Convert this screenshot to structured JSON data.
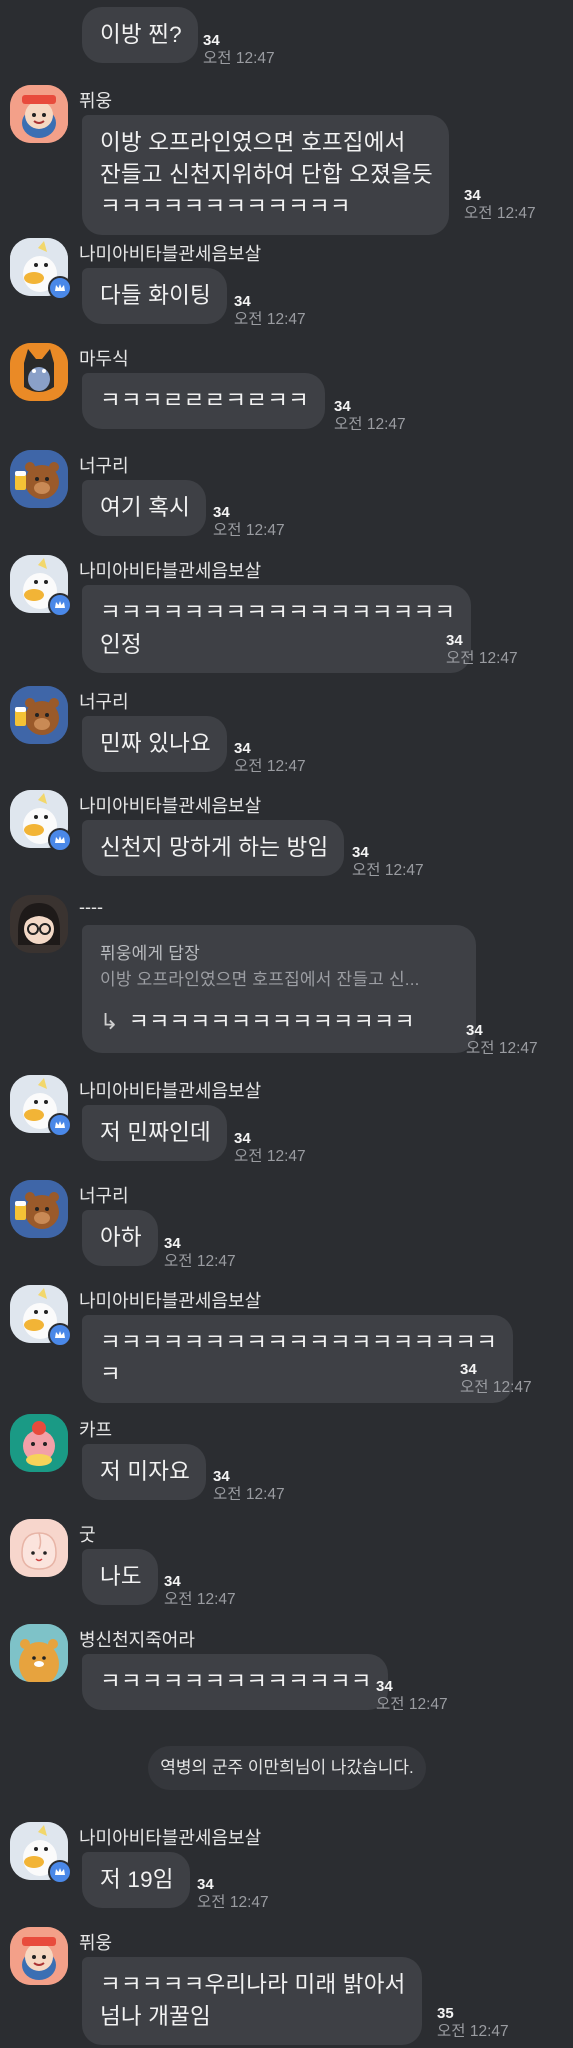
{
  "messages": [
    {
      "sender": "",
      "lines": [
        "이방 찐?"
      ],
      "count": "34",
      "time": "오전 12:47"
    },
    {
      "sender": "퓌웅",
      "lines": [
        "이방 오프라인였으면 호프집에서",
        "잔들고 신천지위하여 단합 오졌을듯",
        "ㅋㅋㅋㅋㅋㅋㅋㅋㅋㅋㅋㅋ"
      ],
      "count": "34",
      "time": "오전 12:47"
    },
    {
      "sender": "나미아비타블관세음보살",
      "lines": [
        "다들 화이팅"
      ],
      "count": "34",
      "time": "오전 12:47"
    },
    {
      "sender": "마두식",
      "lines": [
        "ㅋㅋㅋㄹㄹㄹㅋㄹㅋㅋ"
      ],
      "count": "34",
      "time": "오전 12:47"
    },
    {
      "sender": "너구리",
      "lines": [
        "여기 혹시"
      ],
      "count": "34",
      "time": "오전 12:47"
    },
    {
      "sender": "나미아비타블관세음보살",
      "lines": [
        "ㅋㅋㅋㅋㅋㅋㅋㅋㅋㅋㅋㅋㅋㅋㅋㅋㅋ",
        "인정"
      ],
      "count": "34",
      "time": "오전 12:47"
    },
    {
      "sender": "너구리",
      "lines": [
        "민짜 있나요"
      ],
      "count": "34",
      "time": "오전 12:47"
    },
    {
      "sender": "나미아비타블관세음보살",
      "lines": [
        "신천지 망하게 하는 방임"
      ],
      "count": "34",
      "time": "오전 12:47"
    },
    {
      "sender": "----",
      "reply_to": "퓌웅에게 답장",
      "quote": "이방 오프라인였으면 호프집에서 잔들고 신...",
      "lines": [
        "ㅋㅋㅋㅋㅋㅋㅋㅋㅋㅋㅋㅋㅋㅋ"
      ],
      "count": "34",
      "time": "오전 12:47"
    },
    {
      "sender": "나미아비타블관세음보살",
      "lines": [
        "저 민짜인데"
      ],
      "count": "34",
      "time": "오전 12:47"
    },
    {
      "sender": "너구리",
      "lines": [
        "아하"
      ],
      "count": "34",
      "time": "오전 12:47"
    },
    {
      "sender": "나미아비타블관세음보살",
      "lines": [
        "ㅋㅋㅋㅋㅋㅋㅋㅋㅋㅋㅋㅋㅋㅋㅋㅋㅋㅋㅋ",
        "ㅋ"
      ],
      "count": "34",
      "time": "오전 12:47"
    },
    {
      "sender": "카프",
      "lines": [
        "저 미자요"
      ],
      "count": "34",
      "time": "오전 12:47"
    },
    {
      "sender": "굿",
      "lines": [
        "나도"
      ],
      "count": "34",
      "time": "오전 12:47"
    },
    {
      "sender": "병신천지죽어라",
      "lines": [
        "ㅋㅋㅋㅋㅋㅋㅋㅋㅋㅋㅋㅋㅋ"
      ],
      "count": "34",
      "time": "오전 12:47"
    },
    {
      "sender": "나미아비타블관세음보살",
      "lines": [
        "저 19임"
      ],
      "count": "34",
      "time": "오전 12:47"
    },
    {
      "sender": "퓌웅",
      "lines": [
        "ㅋㅋㅋㅋㅋ우리나라 미래 밝아서",
        "넘나 개꿀임"
      ],
      "count": "35",
      "time": "오전 12:47"
    }
  ],
  "notice": "역병의 군주 이만희님이 나갔습니다.",
  "avatar_styles": {
    "punch": {
      "bg": "#f3a089",
      "icon": "punch-character-avatar-icon"
    },
    "duck": {
      "bg": "#dfe6ee",
      "icon": "duck-character-avatar-icon"
    },
    "muzi": {
      "bg": "#ea8a26",
      "icon": "black-cat-avatar-icon"
    },
    "bear": {
      "bg": "#3f66a8",
      "icon": "bear-with-beer-avatar-icon"
    },
    "girl": {
      "bg": "#3a3330",
      "icon": "girl-with-glasses-avatar-icon"
    },
    "frog": {
      "bg": "#1a9a85",
      "icon": "pink-character-avatar-icon"
    },
    "peach": {
      "bg": "#f7d6cc",
      "icon": "peach-avatar-icon"
    },
    "lion": {
      "bg": "#7ec2c8",
      "icon": "lion-avatar-icon"
    }
  },
  "colors": {
    "background": "#2b2d31",
    "bubble": "#3e4045",
    "text": "#f2f2f2",
    "time": "#9a9ca1",
    "crown_badge": "#4a88e8"
  }
}
